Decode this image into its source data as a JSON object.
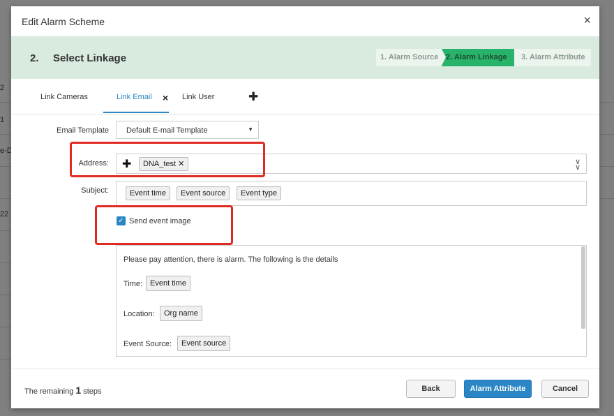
{
  "background": {
    "row_labels": [
      "2",
      "1",
      "e-D",
      "22"
    ]
  },
  "modal": {
    "title": "Edit Alarm Scheme",
    "close_glyph": "×"
  },
  "step": {
    "number": "2.",
    "title": "Select Linkage",
    "wizard": [
      "1. Alarm Source",
      "2. Alarm Linkage",
      "3. Alarm Attribute"
    ],
    "active_index": 1
  },
  "tabs": {
    "items": [
      "Link Cameras",
      "Link Email",
      "Link User"
    ],
    "active": "Link Email",
    "close_glyph": "×",
    "add_glyph": "✚"
  },
  "form": {
    "email_template_label": "Email Template",
    "email_template_value": "Default E-mail Template",
    "address_label": "Address:",
    "address_chips": [
      "DNA_test"
    ],
    "subject_label": "Subject:",
    "subject_chips": [
      "Event time",
      "Event source",
      "Event type"
    ],
    "send_event_image_label": "Send event image",
    "send_event_image_checked": true
  },
  "body_content": {
    "intro": "Please pay attention, there is alarm. The following is the details",
    "time_label": "Time:",
    "time_chip": "Event time",
    "location_label": "Location:",
    "location_chip": "Org name",
    "source_label": "Event Source:",
    "source_chip": "Event source"
  },
  "footer": {
    "remaining_prefix": "The remaining",
    "remaining_count": "1",
    "remaining_suffix": "steps",
    "back_label": "Back",
    "next_label": "Alarm Attribute",
    "cancel_label": "Cancel"
  },
  "colors": {
    "accent": "#2a86c5",
    "wizard_active": "#27b36a",
    "highlight_box": "#e12a24",
    "step_band": "#d9eadf"
  }
}
